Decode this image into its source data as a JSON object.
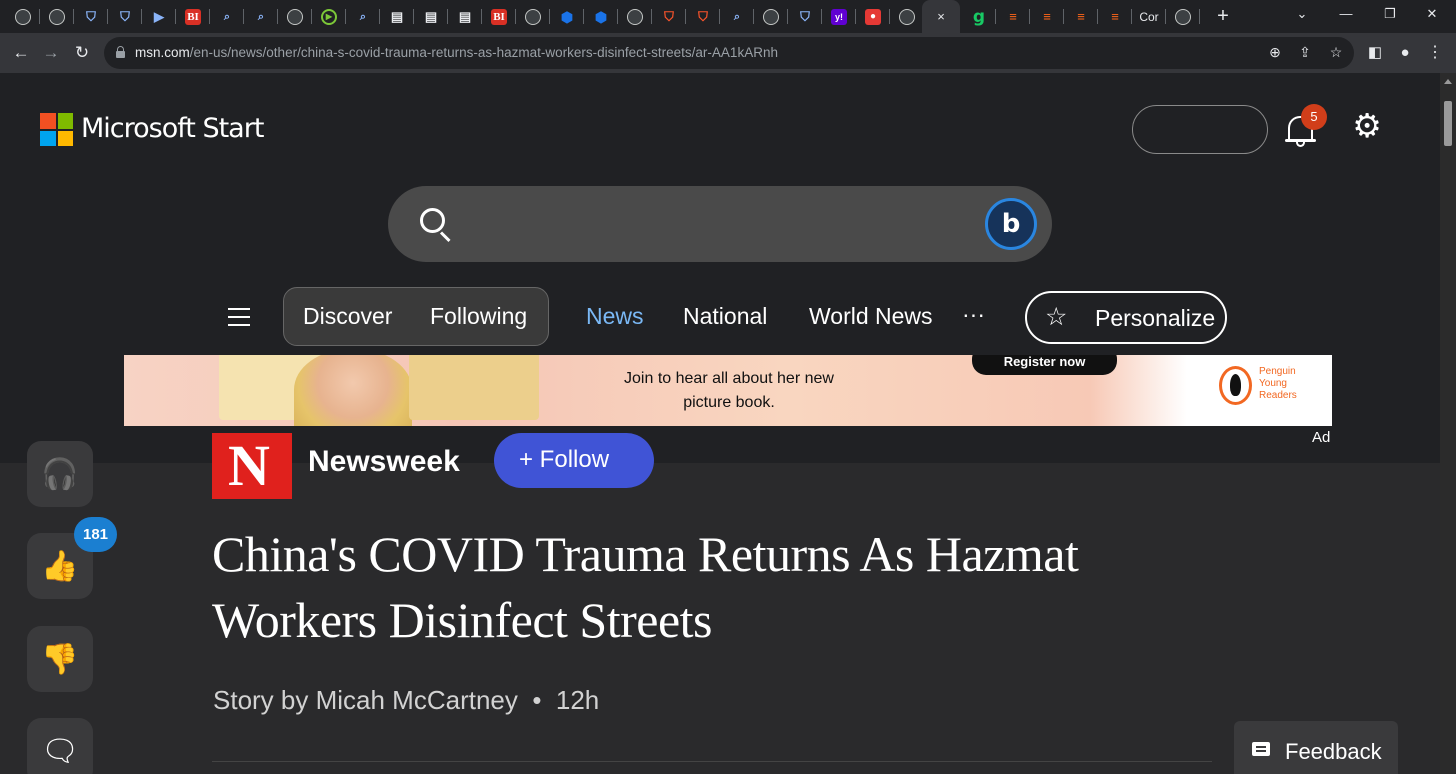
{
  "browser": {
    "tabs": [
      {
        "icon": "globe"
      },
      {
        "icon": "globe"
      },
      {
        "icon": "shield"
      },
      {
        "icon": "shield"
      },
      {
        "icon": "arrow-tag"
      },
      {
        "icon": "bi",
        "text": "BI"
      },
      {
        "icon": "search"
      },
      {
        "icon": "search"
      },
      {
        "icon": "globe"
      },
      {
        "icon": "play"
      },
      {
        "icon": "search"
      },
      {
        "icon": "book"
      },
      {
        "icon": "book"
      },
      {
        "icon": "book"
      },
      {
        "icon": "bi",
        "text": "BI"
      },
      {
        "icon": "globe"
      },
      {
        "icon": "hex"
      },
      {
        "icon": "hex"
      },
      {
        "icon": "globe"
      },
      {
        "icon": "brave"
      },
      {
        "icon": "brave"
      },
      {
        "icon": "search"
      },
      {
        "icon": "globe"
      },
      {
        "icon": "shield"
      },
      {
        "icon": "yahoo",
        "text": "y!"
      },
      {
        "icon": "red"
      },
      {
        "icon": "globe"
      }
    ],
    "active_tab_close": "×",
    "tabs_after": [
      {
        "icon": "g",
        "text": "g"
      },
      {
        "icon": "substack"
      },
      {
        "icon": "substack"
      },
      {
        "icon": "substack"
      },
      {
        "icon": "substack"
      },
      {
        "icon": "text",
        "text": "Cor"
      },
      {
        "icon": "globe"
      }
    ],
    "new_tab": "+",
    "url_host": "msn.com",
    "url_path": "/en-us/news/other/china-s-covid-trauma-returns-as-hazmat-workers-disinfect-streets/ar-AA1kARnh"
  },
  "header": {
    "brand": "Microsoft Start",
    "logo_colors": [
      "#f25022",
      "#7fba00",
      "#00a4ef",
      "#ffb900"
    ],
    "notification_count": "5"
  },
  "nav": {
    "pills": [
      "Discover",
      "Following"
    ],
    "items": [
      {
        "label": "News",
        "active": true
      },
      {
        "label": "National",
        "active": false
      },
      {
        "label": "World News",
        "active": false
      }
    ],
    "more": "···",
    "personalize": "Personalize",
    "active_color": "#7ab8f5"
  },
  "ad": {
    "cta": "Register now",
    "copy_line1": "Join to hear all about her new",
    "copy_line2": "picture book.",
    "publisher_line1": "Penguin",
    "publisher_line2": "Young",
    "publisher_line3": "Readers",
    "label": "Ad"
  },
  "article": {
    "publisher": "Newsweek",
    "publisher_logo_letter": "N",
    "follow": "+ Follow",
    "headline": "China's COVID Trauma Returns As Hazmat Workers Disinfect Streets",
    "author": "Story by Micah McCartney",
    "separator": "•",
    "age": "12h",
    "like_count": "181"
  },
  "feedback": "Feedback"
}
